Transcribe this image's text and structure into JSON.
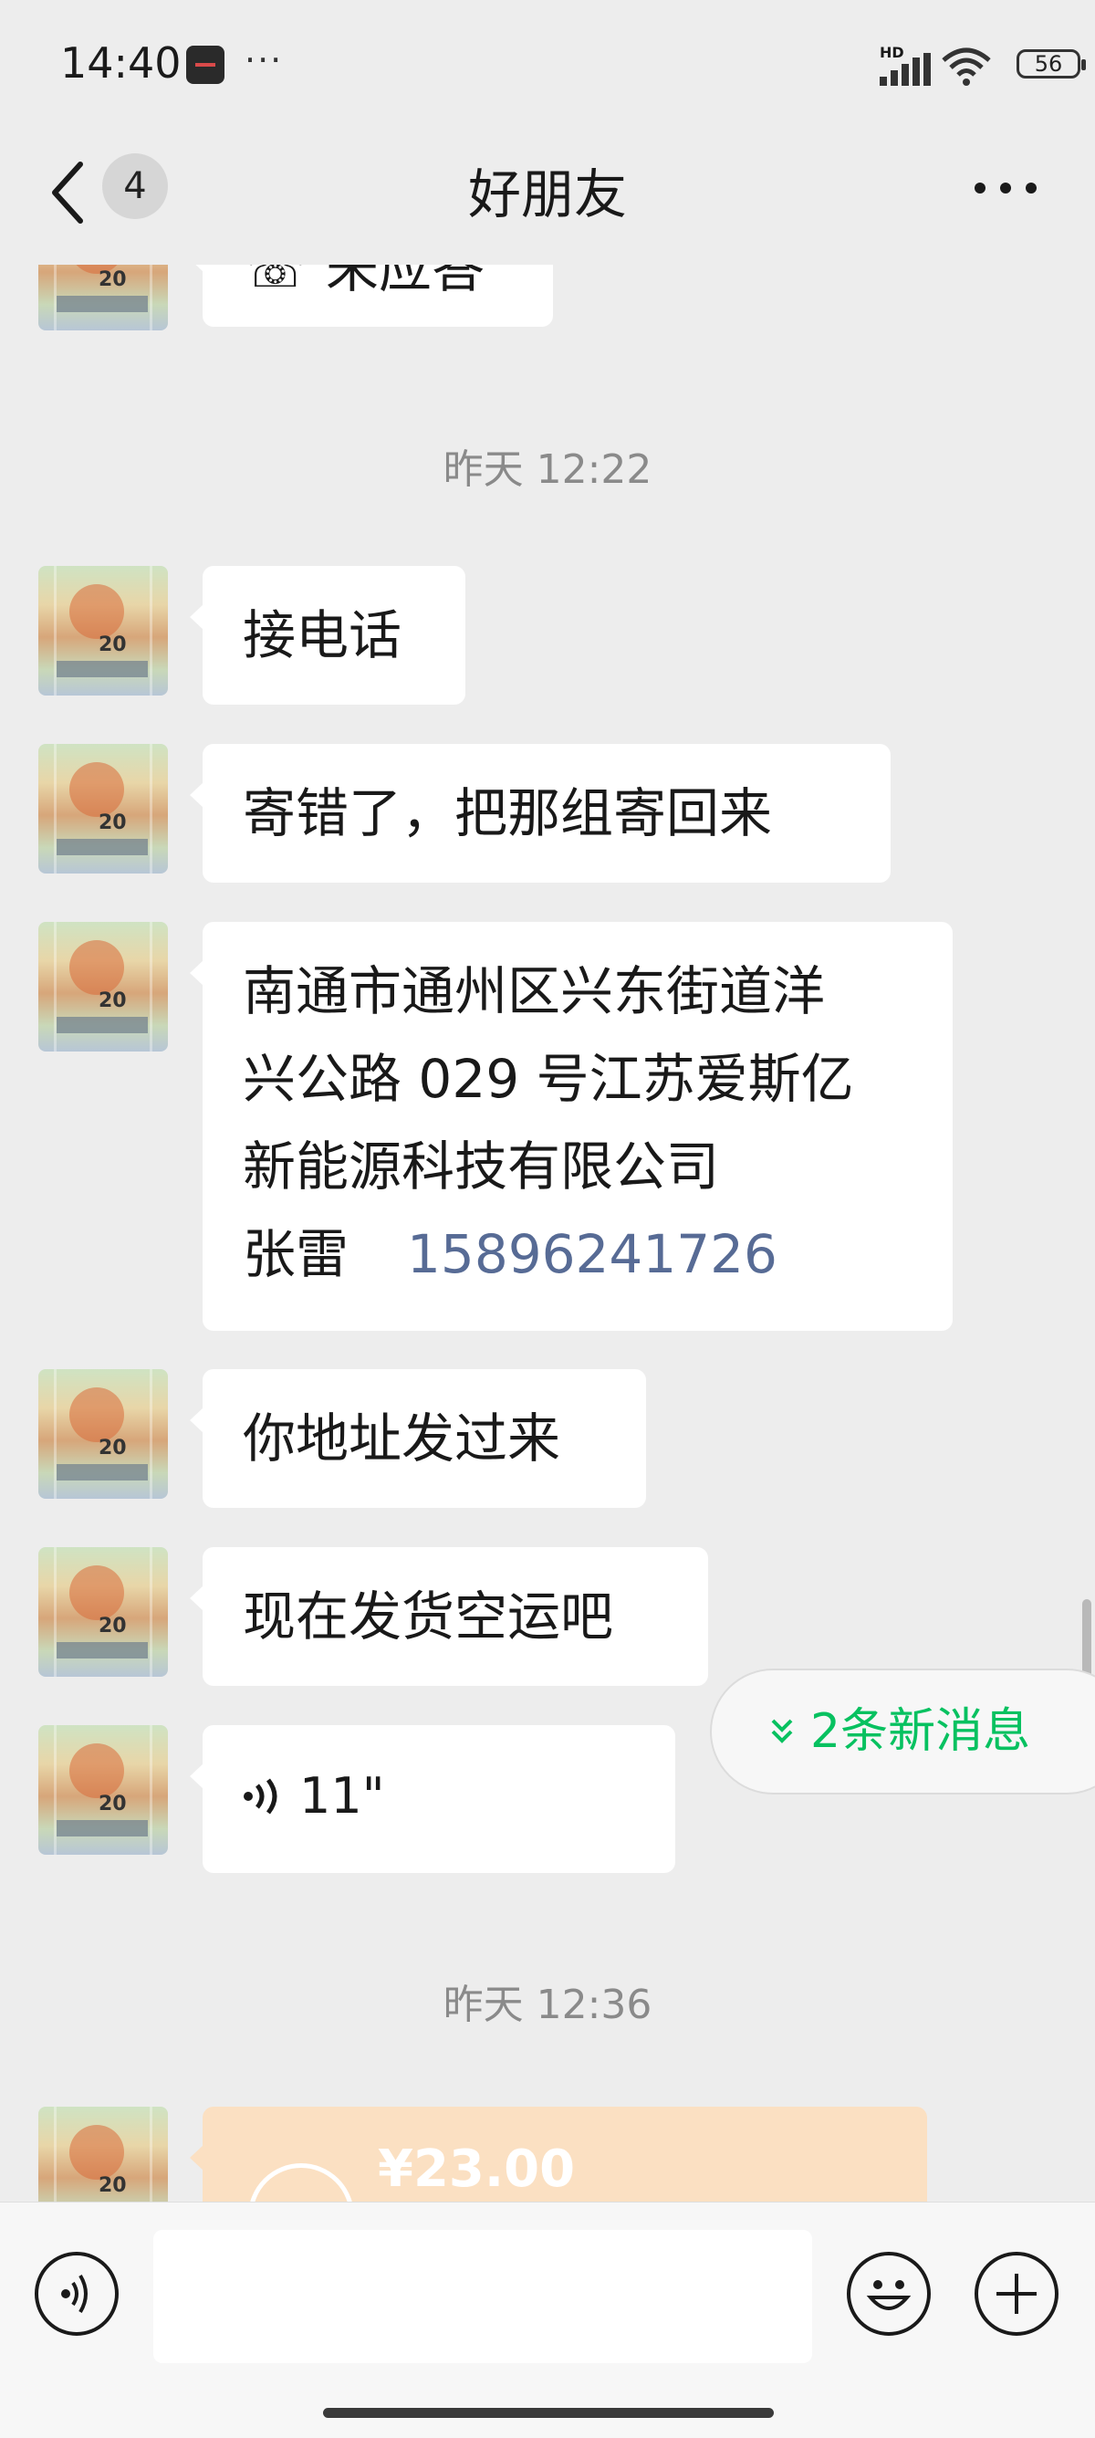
{
  "status_bar": {
    "time": "14:40",
    "more": "···",
    "network": "HD",
    "battery": "56"
  },
  "nav": {
    "unread_count": "4",
    "title": "好朋友"
  },
  "chat": {
    "partial_top_text": "未应答",
    "time_1": "昨天 12:22",
    "msg_1": "接电话",
    "msg_2": "寄错了，把那组寄回来",
    "address_lines": [
      "南通市通州区兴东街道洋",
      "兴公路 029 号江苏爱斯亿",
      "新能源科技有限公司"
    ],
    "address_name": "张雷",
    "address_phone": "15896241726",
    "msg_4": "你地址发过来",
    "msg_5": "现在发货空运吧",
    "voice_duration": "11\"",
    "time_2": "昨天 12:36",
    "new_messages": "2条新消息",
    "transfer_amount": "¥23.00"
  },
  "colors": {
    "background": "#ededed",
    "bubble": "#ffffff",
    "link": "#576b95",
    "accent_green": "#07c160",
    "transfer": "#fbe0c2"
  },
  "icons": [
    "back-icon",
    "more-icon",
    "voice-icon",
    "emoji-icon",
    "plus-icon",
    "chevron-down-icon",
    "transfer-icon"
  ]
}
